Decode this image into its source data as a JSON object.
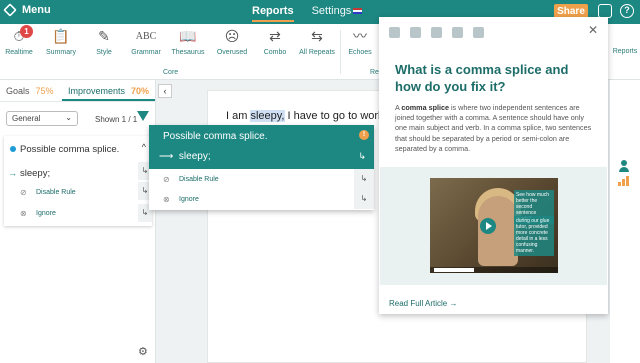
{
  "app": {
    "menu_label": "Menu",
    "tabs": [
      "Reports",
      "Settings"
    ],
    "share_label": "Share",
    "help_label": "?"
  },
  "toolbar": {
    "realtime_badge": "1",
    "items": [
      {
        "label": "Realtime",
        "icon": "stopwatch-icon"
      },
      {
        "label": "Summary",
        "icon": "clipboard-icon"
      },
      {
        "label": "Style",
        "icon": "pen-icon"
      },
      {
        "label": "Grammar",
        "icon": "abc-icon",
        "glyph": "ABC"
      },
      {
        "label": "Thesaurus",
        "icon": "book-icon"
      },
      {
        "label": "Overused",
        "icon": "face-icon"
      },
      {
        "label": "Combo",
        "icon": "combo-icon"
      },
      {
        "label": "All Repeats",
        "icon": "repeat-icon"
      },
      {
        "label": "Echoes",
        "icon": "wave-icon"
      }
    ],
    "group_core": "Core",
    "group_repeats": "Re",
    "reports_label": "Reports"
  },
  "left_panel": {
    "tab_goals": "Goals",
    "goals_pct": "75%",
    "tab_improvements": "Improvements",
    "improvements_pct": "70%",
    "filter_value": "General",
    "shown": "Shown 1 / 1",
    "card": {
      "title": "Possible comma splice.",
      "replacement": "sleepy;",
      "disable_rule": "Disable Rule",
      "ignore": "Ignore"
    }
  },
  "document": {
    "before": "I am ",
    "highlight": "sleepy,",
    "after": " I have to go to work."
  },
  "popup": {
    "title": "Possible comma splice.",
    "replacement": "sleepy;",
    "disable_rule": "Disable Rule",
    "ignore": "Ignore"
  },
  "article": {
    "title": "What is a comma splice and how do you fix it?",
    "term": "comma splice",
    "body_prefix": "A ",
    "body": " is where two independent sentences are joined together with a comma. A sentence should have only one main subject and verb. In a comma splice, two sentences that should be separated by a period or semi-colon are separated by a comma.",
    "video_caption1": "See how much better the second sentence reads?",
    "video_caption2": "during our glue tutor, provided more concrete detail in a less confusing manner.",
    "read_full": "Read Full Article →"
  },
  "colors": {
    "teal": "#1d8782",
    "orange": "#f0a04b",
    "badge_red": "#e04848"
  }
}
